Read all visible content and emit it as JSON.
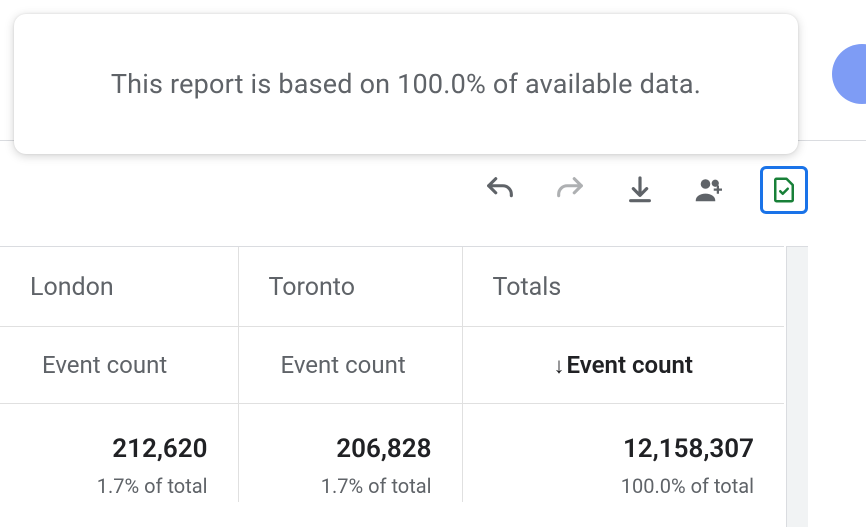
{
  "notice": {
    "text": "This report is based on 100.0% of available data."
  },
  "toolbar": {
    "undo": "undo",
    "redo": "redo",
    "download": "download",
    "share": "share",
    "status": "data-quality"
  },
  "table": {
    "columns": [
      {
        "city": "London",
        "metric": "Event count",
        "value": "212,620",
        "pct": "1.7% of total"
      },
      {
        "city": "Toronto",
        "metric": "Event count",
        "value": "206,828",
        "pct": "1.7% of total"
      },
      {
        "city": "Totals",
        "metric": "Event count",
        "value": "12,158,307",
        "pct": "100.0% of total"
      }
    ],
    "sort_indicator": "↓"
  }
}
